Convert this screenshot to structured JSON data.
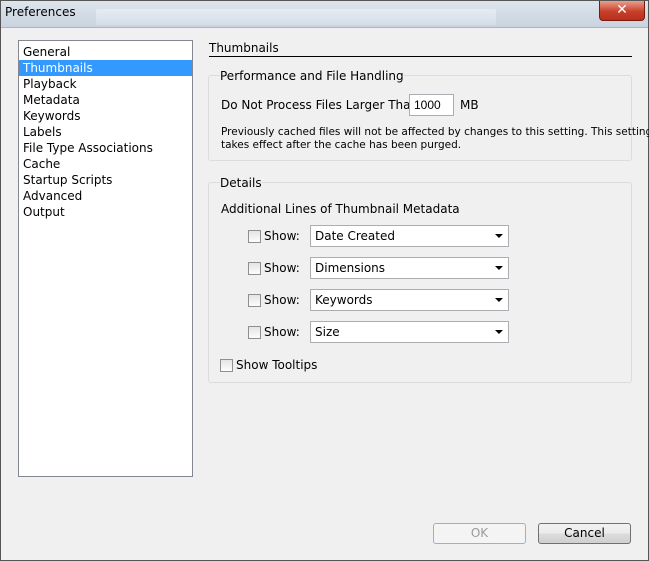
{
  "window": {
    "title": "Preferences",
    "close_glyph": "✕"
  },
  "sidebar": {
    "items": [
      {
        "label": "General"
      },
      {
        "label": "Thumbnails",
        "selected": true
      },
      {
        "label": "Playback"
      },
      {
        "label": "Metadata"
      },
      {
        "label": "Keywords"
      },
      {
        "label": "Labels"
      },
      {
        "label": "File Type Associations"
      },
      {
        "label": "Cache"
      },
      {
        "label": "Startup Scripts"
      },
      {
        "label": "Advanced"
      },
      {
        "label": "Output"
      }
    ]
  },
  "panel": {
    "title": "Thumbnails",
    "performance": {
      "group_title": "Performance and File Handling",
      "max_size_label": "Do Not Process Files Larger Than:",
      "max_size_value": "1000",
      "max_size_unit": "MB",
      "note_line1": "Previously cached files will not be affected by changes to this setting. This setting",
      "note_line2": "takes effect after the cache has been purged."
    },
    "details": {
      "group_title": "Details",
      "metadata_heading": "Additional Lines of Thumbnail Metadata",
      "rows": [
        {
          "show_label": "Show:",
          "checked": false,
          "value": "Date Created"
        },
        {
          "show_label": "Show:",
          "checked": false,
          "value": "Dimensions"
        },
        {
          "show_label": "Show:",
          "checked": false,
          "value": "Keywords"
        },
        {
          "show_label": "Show:",
          "checked": false,
          "value": "Size"
        }
      ],
      "tooltips_label": "Show Tooltips",
      "tooltips_checked": false
    }
  },
  "buttons": {
    "ok_label": "OK",
    "ok_enabled": false,
    "cancel_label": "Cancel"
  },
  "colors": {
    "selection": "#3399ff",
    "close_button": "#c8402a"
  }
}
